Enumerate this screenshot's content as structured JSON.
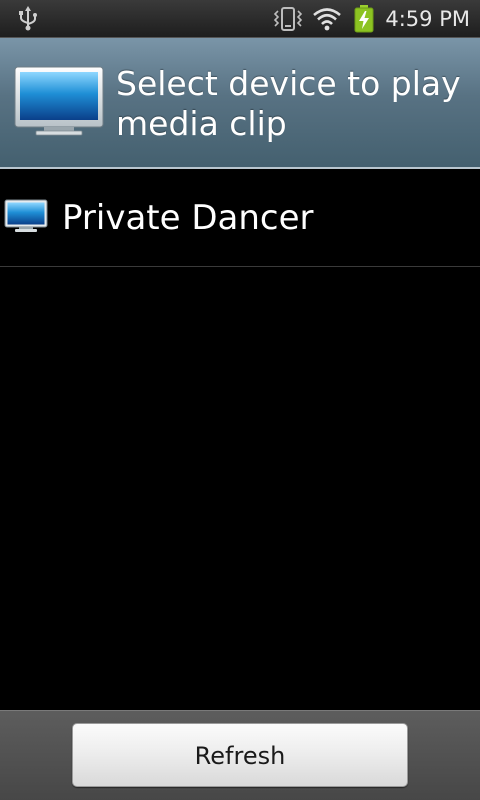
{
  "status_bar": {
    "time": "4:59 PM",
    "icons": [
      "usb-icon",
      "vibrate-icon",
      "wifi-icon",
      "battery-charging-icon"
    ]
  },
  "dialog": {
    "title": "Select device to play media clip",
    "icon": "tv-monitor-icon",
    "colors": {
      "header_top": "#7a95a8",
      "header_bottom": "#44606f"
    }
  },
  "devices": [
    {
      "name": "Private Dancer",
      "icon": "tv-monitor-icon"
    }
  ],
  "actions": {
    "refresh_label": "Refresh"
  }
}
